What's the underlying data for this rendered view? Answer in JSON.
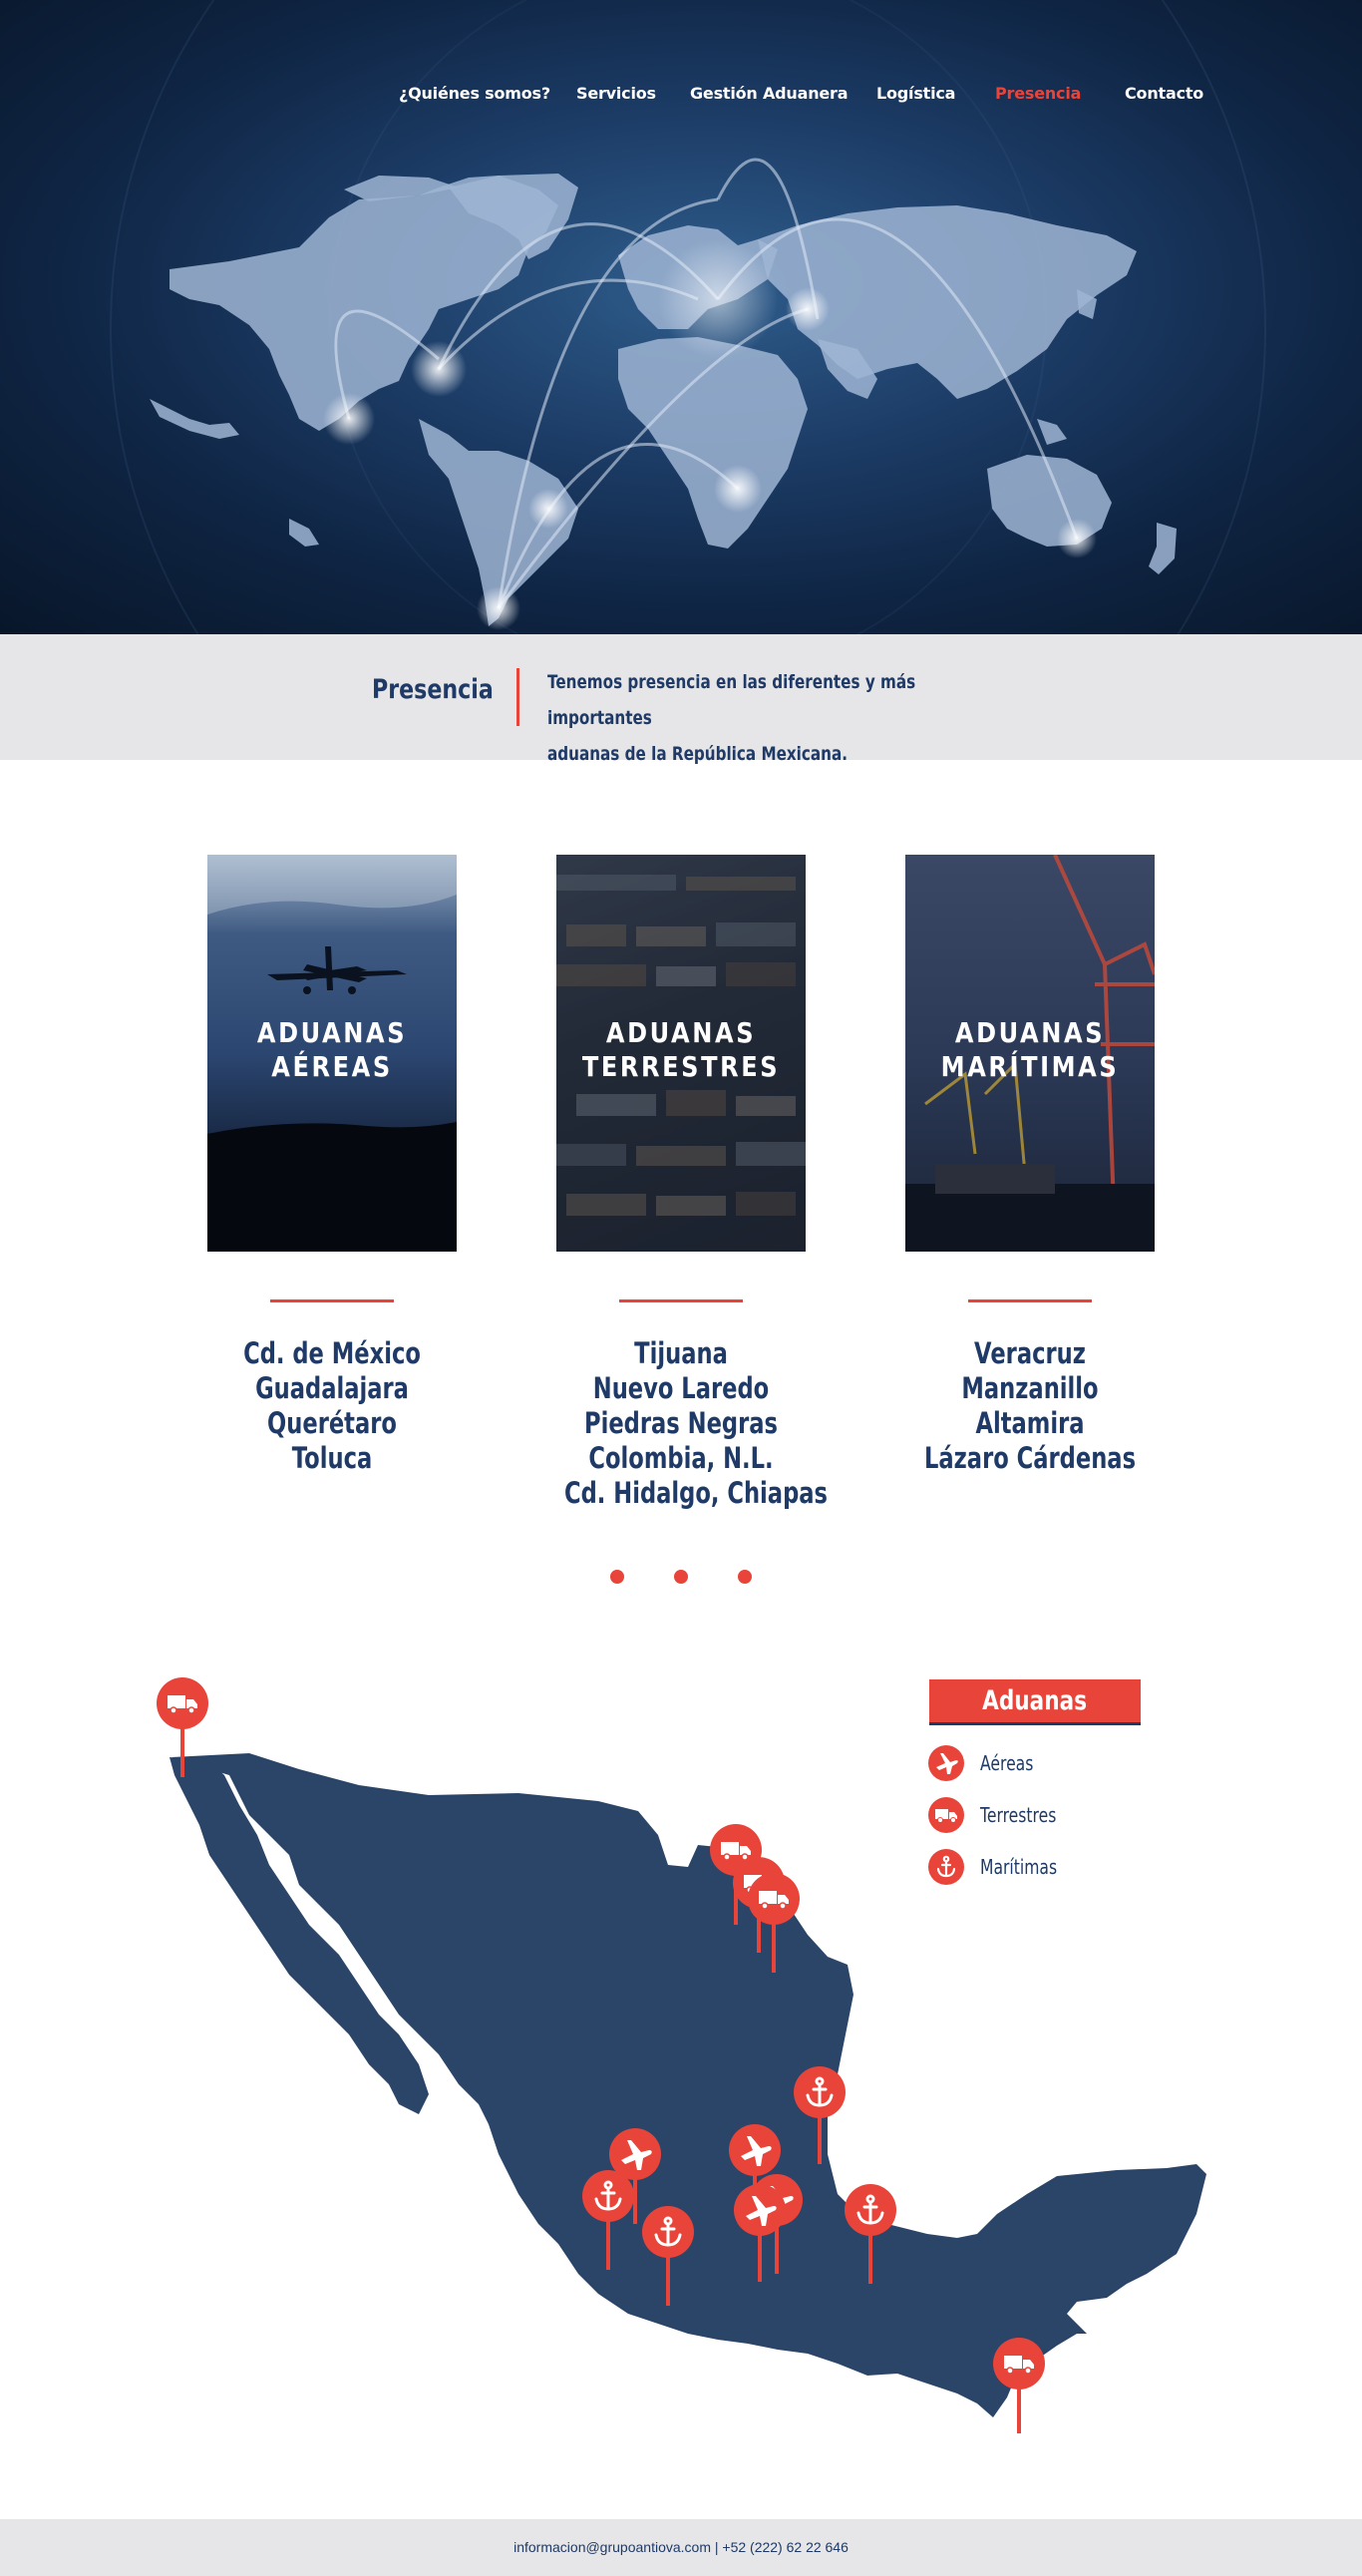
{
  "nav": {
    "items": [
      {
        "label": "¿Quiénes somos?"
      },
      {
        "label": "Servicios"
      },
      {
        "label": "Gestión Aduanera"
      },
      {
        "label": "Logística"
      },
      {
        "label": "Presencia",
        "active": true
      },
      {
        "label": "Contacto"
      }
    ]
  },
  "presence": {
    "title": "Presencia",
    "text_line1": "Tenemos presencia en las diferentes y más importantes",
    "text_line2": "aduanas de la República Mexicana."
  },
  "cards": [
    {
      "title_line1": "ADUANAS",
      "title_line2": "AÉREAS",
      "cities": [
        "Cd. de México",
        "Guadalajara",
        "Querétaro",
        "Toluca"
      ]
    },
    {
      "title_line1": "ADUANAS",
      "title_line2": "TERRESTRES",
      "cities": [
        "Tijuana",
        "Nuevo Laredo",
        "Piedras Negras",
        "Colombia, N.L.",
        "Cd. Hidalgo, Chiapas"
      ]
    },
    {
      "title_line1": "ADUANAS",
      "title_line2": "MARÍTIMAS",
      "cities": [
        "Veracruz",
        "Manzanillo",
        "Altamira",
        "Lázaro Cárdenas"
      ]
    }
  ],
  "legend": {
    "title": "Aduanas",
    "items": [
      {
        "label": "Aéreas",
        "icon": "plane-icon"
      },
      {
        "label": "Terrestres",
        "icon": "truck-icon"
      },
      {
        "label": "Marítimas",
        "icon": "anchor-icon"
      }
    ]
  },
  "footer": {
    "text": "informacion@grupoantiova.com | +52 (222) 62 22 646"
  },
  "colors": {
    "accent": "#e8443a",
    "navy": "#1f3a66",
    "map": "#2a4568",
    "band": "#e6e6e8"
  }
}
